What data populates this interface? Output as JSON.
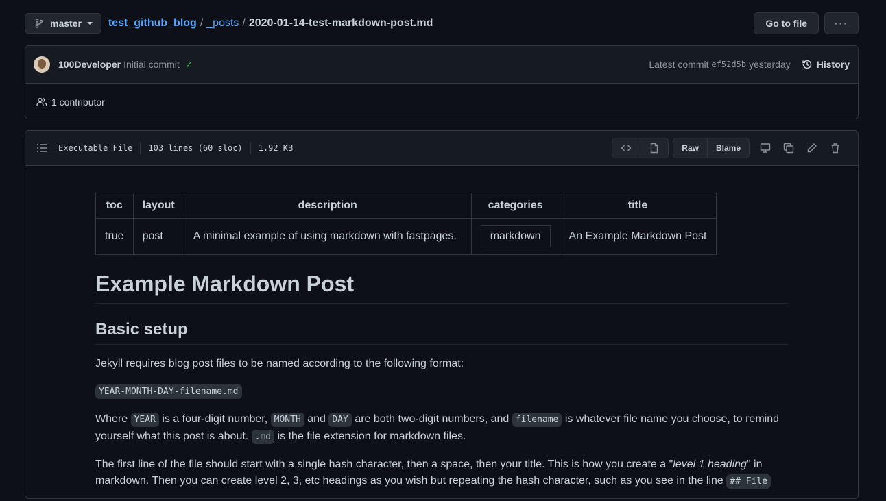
{
  "top": {
    "branch": "master",
    "crumbs": {
      "repo": "test_github_blog",
      "sep1": "/",
      "dir": "_posts",
      "sep2": "/",
      "file": "2020-01-14-test-markdown-post.md"
    },
    "go_to_file": "Go to file",
    "more": "···"
  },
  "commit": {
    "author": "100Developer",
    "message": "Initial commit",
    "check": "✓",
    "latest_label": "Latest commit",
    "sha": "ef52d5b",
    "when": "yesterday",
    "history": "History",
    "contributors": "1 contributor"
  },
  "file": {
    "mode": "Executable File",
    "lines": "103 lines (60 sloc)",
    "size": "1.92 KB",
    "raw": "Raw",
    "blame": "Blame"
  },
  "frontmatter": {
    "headers": [
      "toc",
      "layout",
      "description",
      "categories",
      "title"
    ],
    "row": [
      "true",
      "post",
      "A minimal example of using markdown with fastpages.",
      "markdown",
      "An Example Markdown Post"
    ]
  },
  "content": {
    "h1": "Example Markdown Post",
    "h2": "Basic setup",
    "p1": "Jekyll requires blog post files to be named according to the following format:",
    "format": "YEAR-MONTH-DAY-filename.md",
    "p2": {
      "t1": "Where ",
      "c1": "YEAR",
      "t2": " is a four-digit number, ",
      "c2": "MONTH",
      "t3": " and ",
      "c3": "DAY",
      "t4": " are both two-digit numbers, and ",
      "c4": "filename",
      "t5": " is whatever file name you choose, to remind yourself what this post is about. ",
      "c5": ".md",
      "t6": " is the file extension for markdown files."
    },
    "p3": {
      "t1": "The first line of the file should start with a single hash character, then a space, then your title. This is how you create a \"",
      "em": "level 1 heading",
      "t2": "\" in markdown. Then you can create level 2, 3, etc headings as you wish but repeating the hash character, such as you see in the line ",
      "c1": "## File"
    }
  }
}
